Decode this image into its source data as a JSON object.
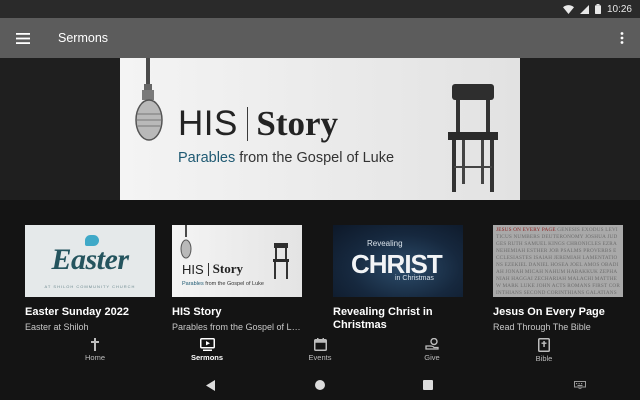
{
  "status_bar": {
    "time": "10:26"
  },
  "app_bar": {
    "title": "Sermons"
  },
  "banner": {
    "title_left": "HIS",
    "title_right": "Story",
    "subtitle_highlight": "Parables",
    "subtitle_rest": "from the Gospel of Luke"
  },
  "cards": [
    {
      "title": "Easter Sunday 2022",
      "subtitle": "Easter at Shiloh",
      "thumb_text": "Easter",
      "thumb_tag": "AT SHILOH COMMUNITY CHURCH"
    },
    {
      "title": "HIS Story",
      "subtitle": "Parables from the Gospel of Luke",
      "thumb_left": "HIS",
      "thumb_right": "Story",
      "thumb_highlight": "Parables",
      "thumb_rest": "from the Gospel of Luke"
    },
    {
      "title": "Revealing Christ in Christmas",
      "subtitle": "",
      "thumb_top": "Revealing",
      "thumb_main": "CHRIST",
      "thumb_bottom": "in Christmas"
    },
    {
      "title": "Jesus On Every Page",
      "subtitle": "Read Through The Bible",
      "thumb_highlight": "JESUS ON EVERY PAGE",
      "thumb_text": "GENESIS EXODUS LEVITICUS NUMBERS DEUTERONOMY JOSHUA JUDGES RUTH SAMUEL KINGS CHRONICLES EZRA NEHEMIAH ESTHER JOB PSALMS PROVERBS ECCLESIASTES ISAIAH JEREMIAH LAMENTATIONS EZEKIEL DANIEL HOSEA JOEL AMOS OBADIAH JONAH MICAH NAHUM HABAKKUK ZEPHANIAH HAGGAI ZECHARIAH MALACHI MATTHEW MARK LUKE JOHN ACTS ROMANS FIRST CORINTHIANS SECOND CORINTHIANS GALATIANS EPHESIANS PHILIPPIANS COLOSSIANS THESSALONIANS TIMOTHY TITUS PHILEMON HEBREWS JAMES PETER JUDE REVELATION"
    }
  ],
  "bottom_nav": [
    {
      "label": "Home",
      "icon": "cross-icon",
      "active": false
    },
    {
      "label": "Sermons",
      "icon": "play-screen-icon",
      "active": true
    },
    {
      "label": "Events",
      "icon": "calendar-icon",
      "active": false
    },
    {
      "label": "Give",
      "icon": "give-hand-icon",
      "active": false
    },
    {
      "label": "Bible",
      "icon": "bible-icon",
      "active": false
    }
  ],
  "colors": {
    "app_bar": "#5c5c5c",
    "background": "#141414",
    "accent_text": "#1f5a73",
    "easter": "#24545e"
  }
}
